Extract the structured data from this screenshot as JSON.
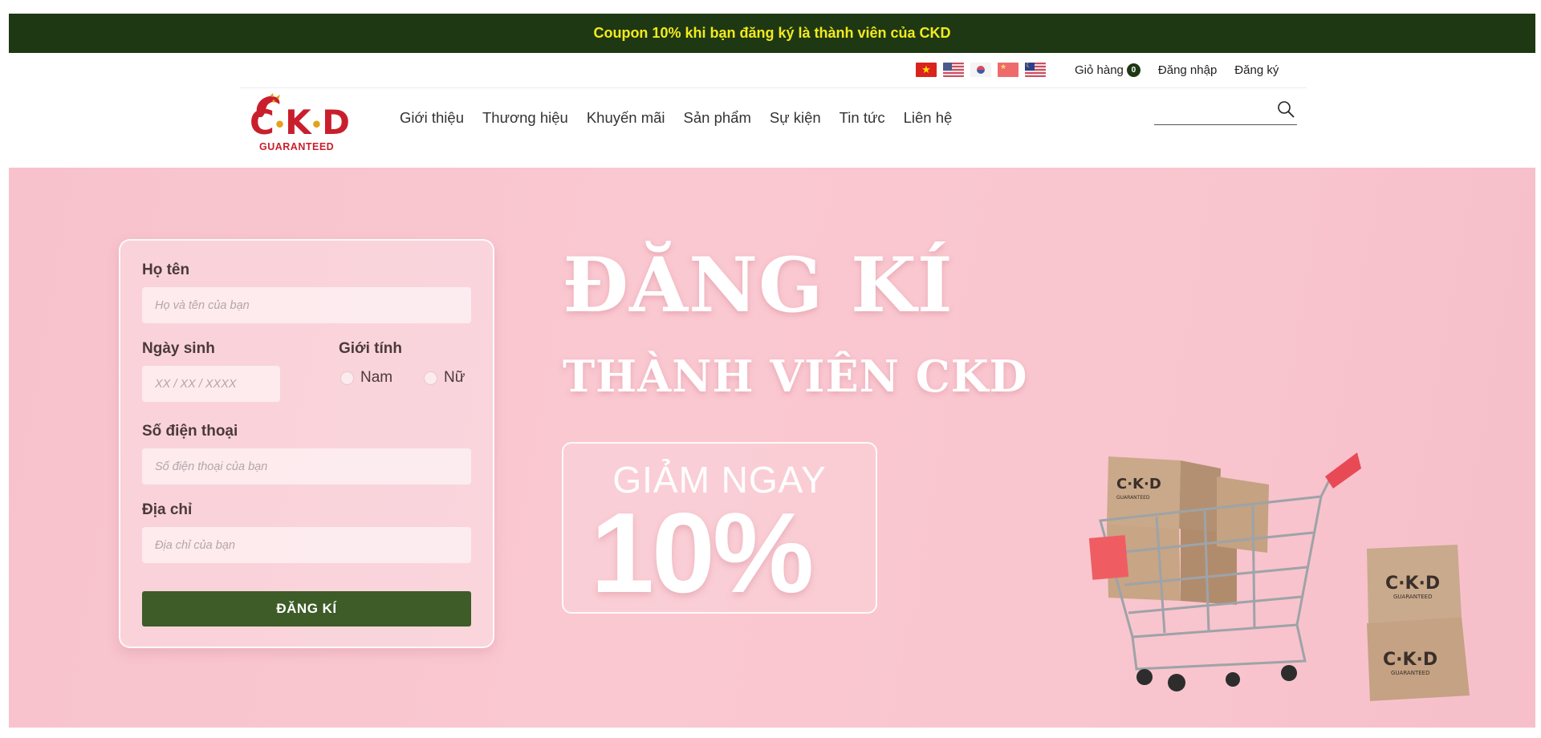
{
  "announcement": {
    "text": "Coupon 10% khi bạn đăng ký là thành viên của CKD"
  },
  "languages": [
    {
      "icon": "flag-vietnam-icon"
    },
    {
      "icon": "flag-usa-icon"
    },
    {
      "icon": "flag-korea-icon"
    },
    {
      "icon": "flag-china-icon"
    },
    {
      "icon": "flag-malaysia-icon"
    }
  ],
  "utility": {
    "cart_label": "Giỏ hàng",
    "cart_count": "0",
    "login": "Đăng nhập",
    "register": "Đăng ký"
  },
  "logo": {
    "letters_c": "C",
    "letters_k": "K",
    "letters_d": "D",
    "dot": "•",
    "sub": "GUARANTEED"
  },
  "nav": {
    "items": [
      {
        "label": "Giới thiệu"
      },
      {
        "label": "Thương hiệu"
      },
      {
        "label": "Khuyến mãi"
      },
      {
        "label": "Sản phẩm"
      },
      {
        "label": "Sự kiện"
      },
      {
        "label": "Tin tức"
      },
      {
        "label": "Liên hệ"
      }
    ]
  },
  "search": {
    "placeholder": "",
    "value": ""
  },
  "form": {
    "name_label": "Họ tên",
    "name_placeholder": "Họ và tên của bạn",
    "dob_label": "Ngày sinh",
    "dob_placeholder": "XX / XX / XXXX",
    "gender_label": "Giới tính",
    "gender_options": [
      "Nam",
      "Nữ"
    ],
    "phone_label": "Số điện thoại",
    "phone_placeholder": "Số điện thoại của bạn",
    "address_label": "Địa chỉ",
    "address_placeholder": "Địa chỉ của bạn",
    "submit_label": "ĐĂNG KÍ"
  },
  "hero": {
    "headline_1": "ĐĂNG KÍ",
    "headline_2": "THÀNH VIÊN CKD",
    "promo_line_1": "GIẢM NGAY",
    "promo_line_2": "10%",
    "box_brand": "C·K·D",
    "box_sub": "GUARANTEED"
  },
  "colors": {
    "announce_bg": "#1e3813",
    "announce_text": "#f2ea1d",
    "brand_red": "#c91f2c",
    "button_green": "#3d5c28",
    "hero_pink": "#f9c6cf"
  }
}
